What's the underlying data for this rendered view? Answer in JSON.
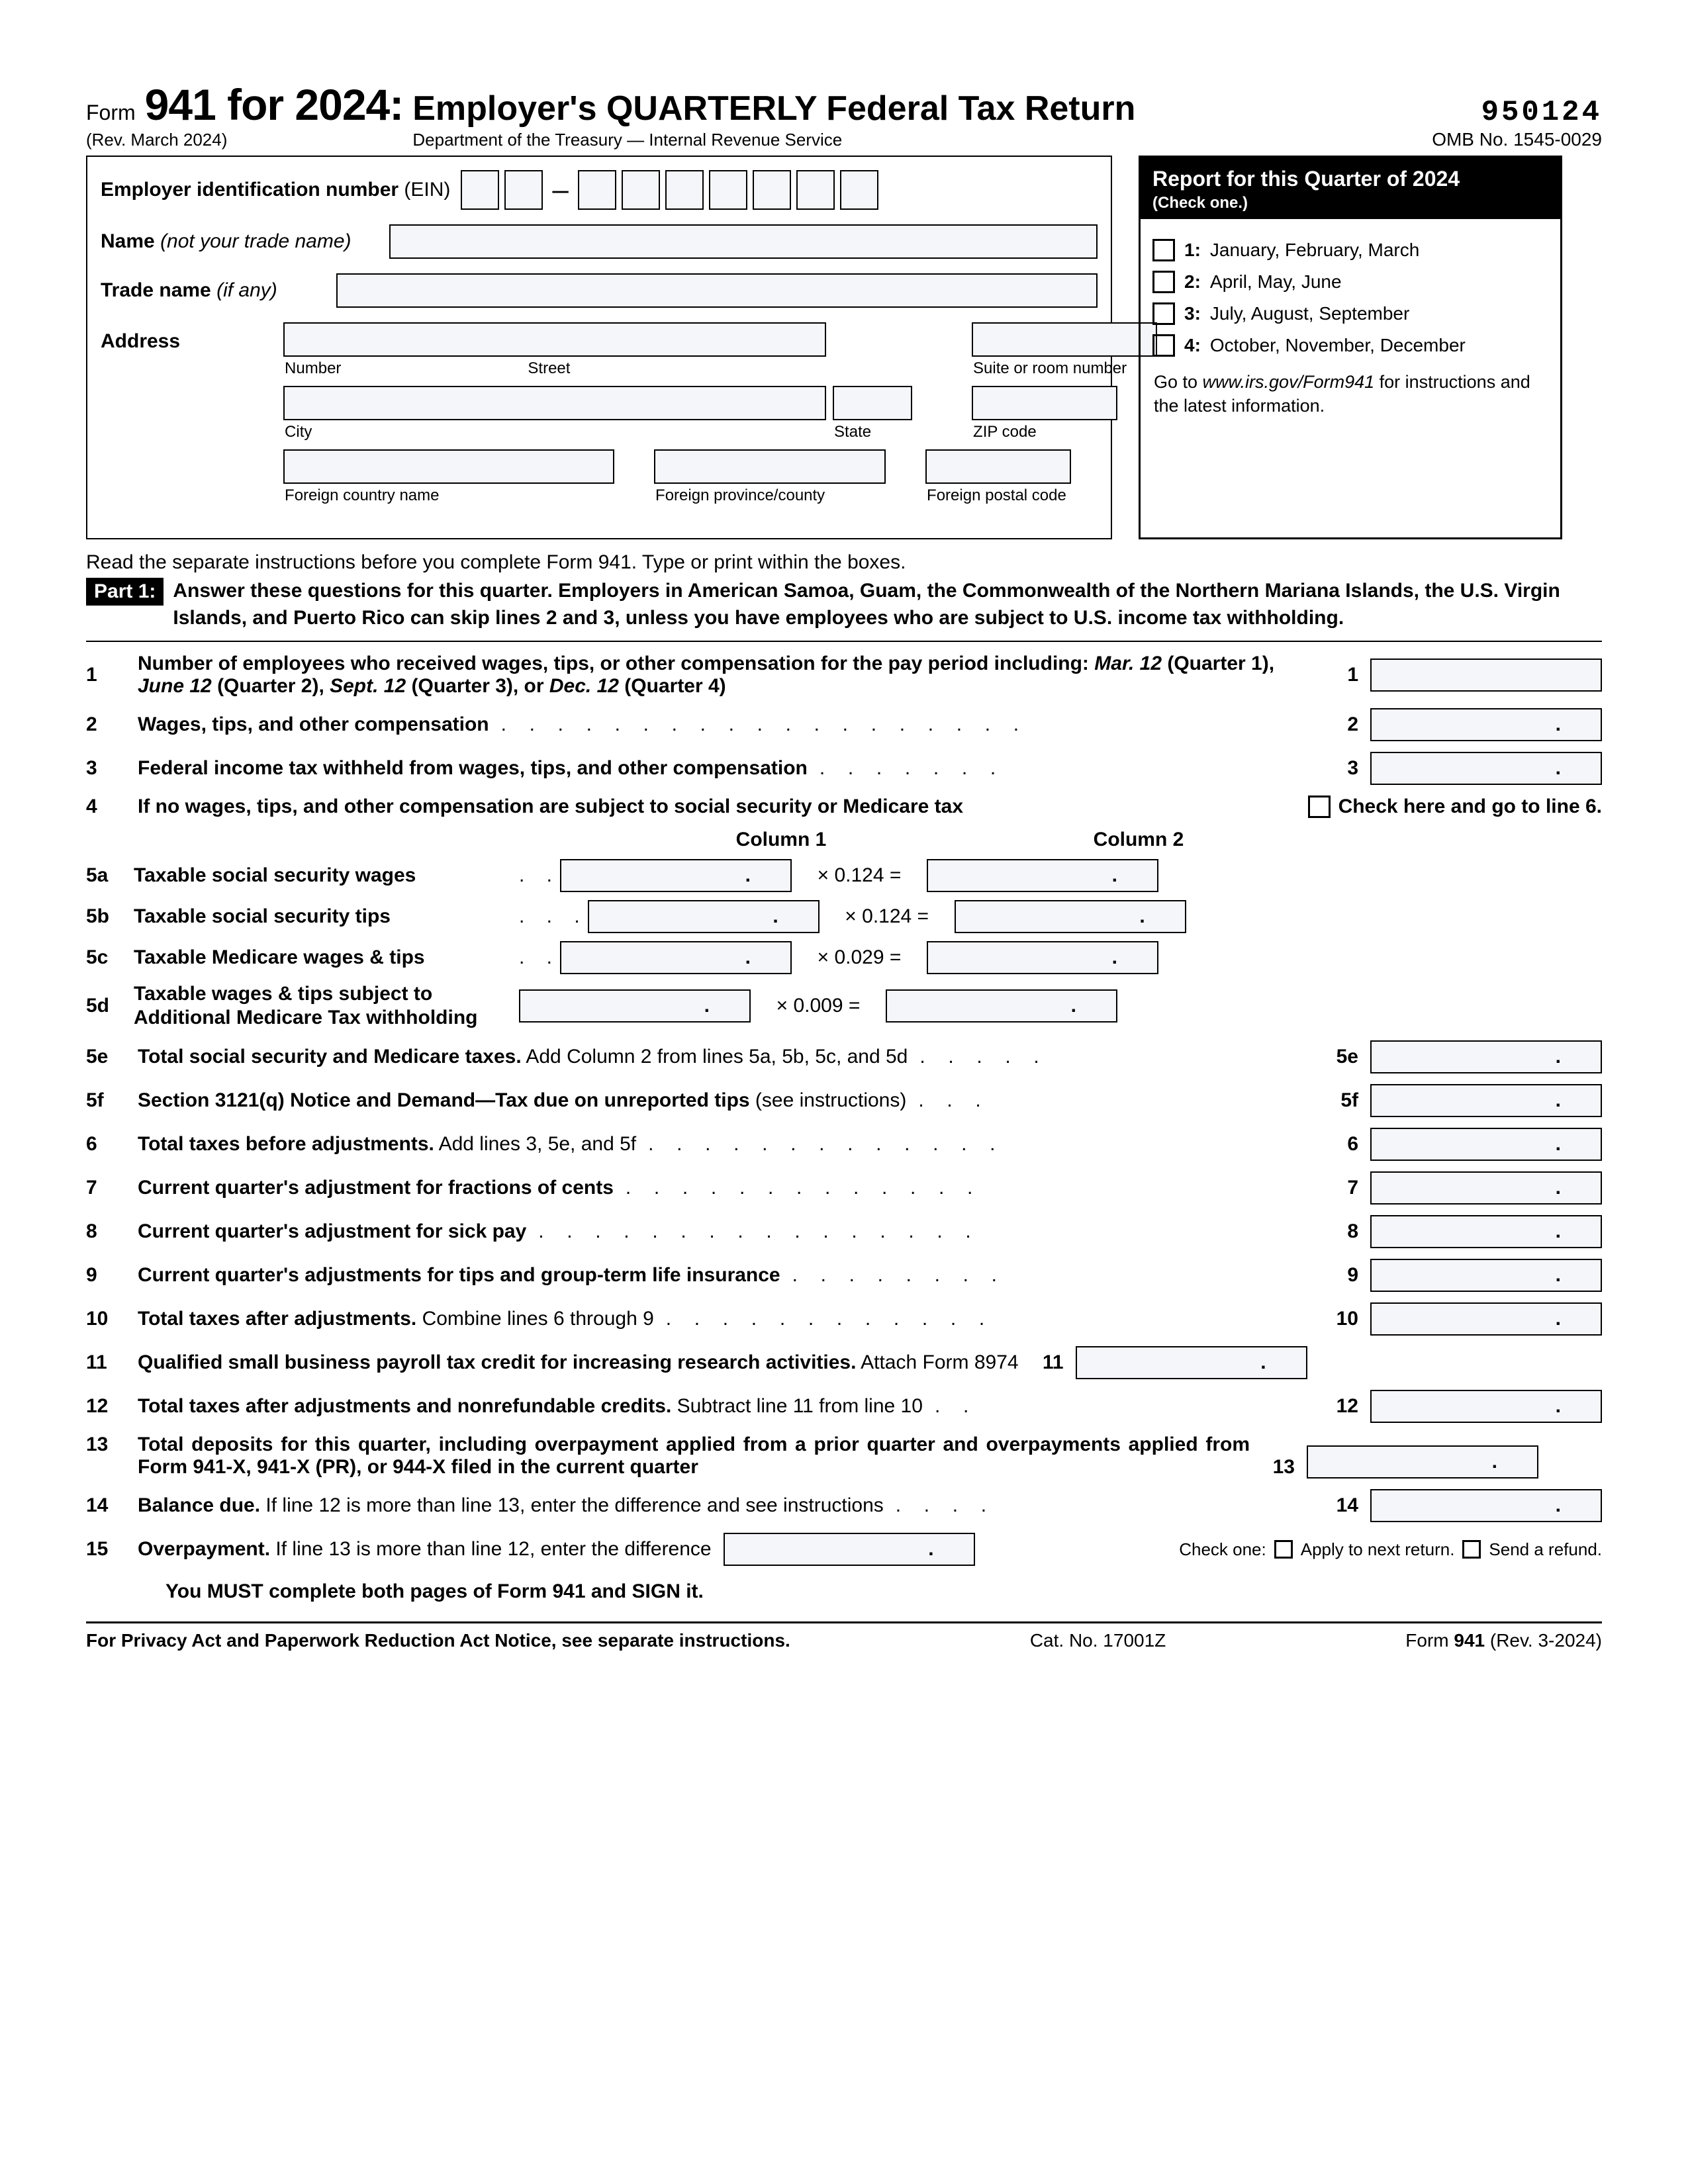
{
  "header": {
    "form_word": "Form",
    "form_num": "941 for 2024:",
    "title": "Employer's QUARTERLY Federal Tax Return",
    "rev": "(Rev. March 2024)",
    "dept": "Department of the Treasury — Internal Revenue Service",
    "code": "950124",
    "omb": "OMB No. 1545-0029"
  },
  "employer": {
    "ein_label": "Employer identification number",
    "ein_paren": "(EIN)",
    "name_label": "Name",
    "name_paren": "(not your trade name)",
    "trade_label": "Trade name",
    "trade_paren": "(if any)",
    "addr_label": "Address",
    "sub_number": "Number",
    "sub_street": "Street",
    "sub_suite": "Suite or room number",
    "sub_city": "City",
    "sub_state": "State",
    "sub_zip": "ZIP code",
    "sub_fcn": "Foreign country name",
    "sub_fpc": "Foreign province/county",
    "sub_fpost": "Foreign postal code"
  },
  "quarter": {
    "title": "Report for this Quarter of 2024",
    "sub": "(Check one.)",
    "opts": [
      {
        "num": "1:",
        "text": "January, February, March"
      },
      {
        "num": "2:",
        "text": "April, May, June"
      },
      {
        "num": "3:",
        "text": "July, August, September"
      },
      {
        "num": "4:",
        "text": "October, November, December"
      }
    ],
    "goto_pre": "Go to ",
    "goto_url": "www.irs.gov/Form941",
    "goto_post": " for instructions and the latest information."
  },
  "instr": "Read the separate instructions before you complete Form 941. Type or print within the boxes.",
  "part1": {
    "tag": "Part 1:",
    "text": "Answer these questions for this quarter. Employers in American Samoa, Guam, the Commonwealth of the Northern Mariana Islands, the U.S. Virgin Islands, and Puerto Rico can skip lines 2 and 3, unless you have employees who are subject to U.S. income tax withholding."
  },
  "lines": {
    "l1_num": "1",
    "l1_a": "Number of employees who received wages, tips, or other compensation for the pay period including: ",
    "l1_b": "Mar. 12",
    "l1_c": " (Quarter 1), ",
    "l1_d": "June 12",
    "l1_e": " (Quarter 2), ",
    "l1_f": "Sept. 12",
    "l1_g": " (Quarter 3), or ",
    "l1_h": "Dec. 12",
    "l1_i": " (Quarter 4)",
    "l2_num": "2",
    "l2": "Wages, tips, and other compensation",
    "l3_num": "3",
    "l3": "Federal income tax withheld from wages, tips, and other compensation",
    "l4_num": "4",
    "l4": "If no wages, tips, and other compensation are subject to social security or Medicare tax",
    "l4_chk": "Check here and go to line 6.",
    "col1": "Column 1",
    "col2": "Column 2",
    "l5a_num": "5a",
    "l5a": "Taxable social security wages",
    "l5a_mult": "× 0.124 =",
    "l5b_num": "5b",
    "l5b": "Taxable social security tips",
    "l5b_mult": "× 0.124 =",
    "l5c_num": "5c",
    "l5c": "Taxable Medicare wages & tips",
    "l5c_mult": "× 0.029 =",
    "l5d_num": "5d",
    "l5d": "Taxable wages & tips subject to",
    "l5d2": "Additional Medicare Tax withholding",
    "l5d_mult": "× 0.009 =",
    "l5e_num": "5e",
    "l5e_b": "Total social security and Medicare taxes.",
    "l5e_r": " Add Column 2 from lines 5a, 5b, 5c, and 5d",
    "l5f_num": "5f",
    "l5f_b": "Section 3121(q) Notice and Demand—Tax due on unreported tips",
    "l5f_r": " (see instructions)",
    "l6_num": "6",
    "l6_b": "Total taxes before adjustments.",
    "l6_r": " Add lines 3, 5e, and 5f",
    "l7_num": "7",
    "l7": "Current quarter's adjustment for fractions of cents",
    "l8_num": "8",
    "l8": "Current quarter's adjustment for sick pay",
    "l9_num": "9",
    "l9": "Current quarter's adjustments for tips and group-term life insurance",
    "l10_num": "10",
    "l10_b": "Total taxes after adjustments.",
    "l10_r": " Combine lines 6 through 9",
    "l11_num": "11",
    "l11_b": "Qualified small business payroll tax credit for increasing research activities.",
    "l11_r": " Attach Form 8974",
    "l12_num": "12",
    "l12_b": "Total taxes after adjustments and nonrefundable credits.",
    "l12_r": " Subtract line 11 from line 10",
    "l13_num": "13",
    "l13": "Total deposits for this quarter, including overpayment applied from a prior quarter and overpayments applied from Form 941-X, 941-X (PR), or 944-X filed in the current quarter",
    "l14_num": "14",
    "l14_b": "Balance due.",
    "l14_r": " If line 12 is more than line 13, enter the difference and see instructions",
    "l15_num": "15",
    "l15_b": "Overpayment.",
    "l15_r": " If line 13 is more than line 12, enter the difference",
    "l15_check": "Check one:",
    "l15_opt1": "Apply to next return.",
    "l15_opt2": "Send a refund."
  },
  "must": "You MUST complete both pages of Form 941 and SIGN it.",
  "footer": {
    "privacy": "For Privacy Act and Paperwork Reduction Act Notice, see separate instructions.",
    "cat": "Cat. No. 17001Z",
    "form_pre": "Form ",
    "form_b": "941",
    "form_post": " (Rev. 3-2024)"
  }
}
